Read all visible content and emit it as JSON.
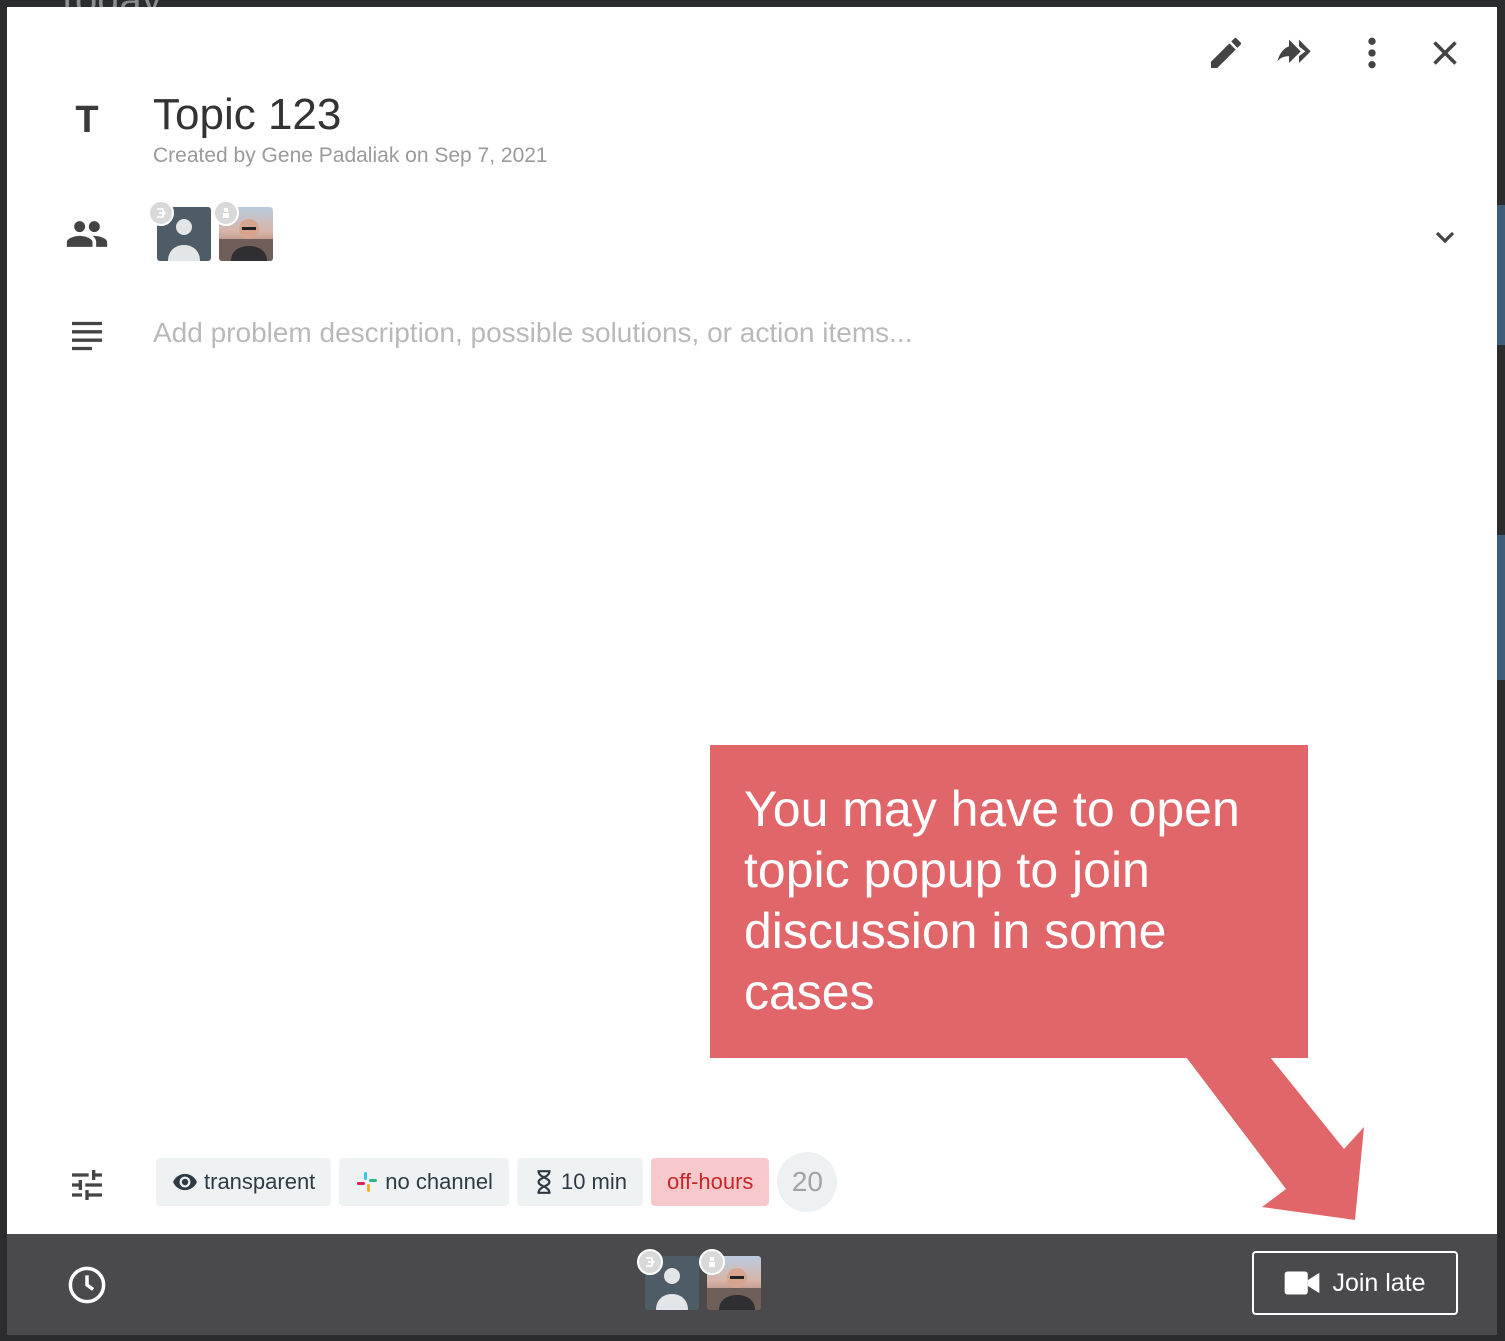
{
  "background": {
    "heading_fragment": "Today"
  },
  "toolbar": {
    "edit_icon": "pencil-icon",
    "share_icon": "double-forward-icon",
    "more_icon": "vertical-dots-icon",
    "close_icon": "close-icon"
  },
  "topic": {
    "type_icon": "T",
    "title": "Topic 123",
    "subtitle": "Created by Gene Padaliak on Sep 7, 2021"
  },
  "participants": {
    "icon": "people-icon",
    "avatars": [
      "default-avatar",
      "photo-avatar"
    ],
    "expand_icon": "chevron-down-icon"
  },
  "description": {
    "icon": "notes-icon",
    "placeholder": "Add problem description, possible solutions, or action items..."
  },
  "settings": {
    "icon": "sliders-icon",
    "chips": [
      {
        "label": "transparent",
        "icon": "eye-icon"
      },
      {
        "label": "no channel",
        "icon": "slack-icon"
      },
      {
        "label": "10 min",
        "icon": "hourglass-icon"
      },
      {
        "label": "off-hours",
        "icon": ""
      }
    ],
    "count": "20"
  },
  "footer": {
    "clock_icon": "clock-icon",
    "join_label": "Join late",
    "join_icon": "video-camera-icon"
  },
  "callout": {
    "text": "You may have to open topic popup to join discussion in some cases"
  },
  "colors": {
    "callout": "#e0666a",
    "footer": "#4a4a4c",
    "offhours_bg": "#f7c9cc",
    "offhours_text": "#c62828"
  }
}
